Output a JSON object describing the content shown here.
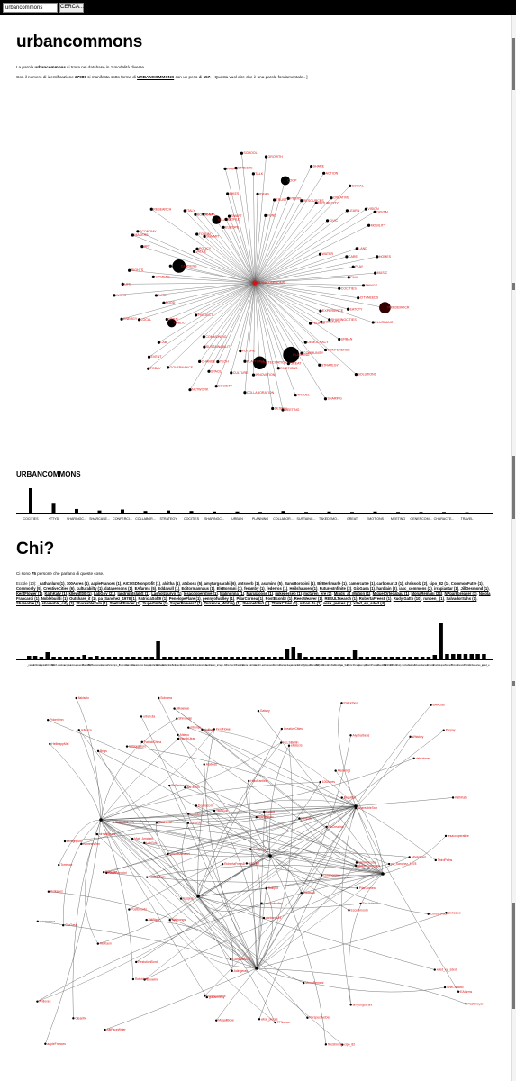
{
  "search": {
    "value": "urbancommons",
    "button_label": "CERCA..."
  },
  "page": {
    "title": "urbancommons"
  },
  "intro": {
    "line1_pre": "La parola ",
    "line1_word": "urbancommons",
    "line1_post": " si trova nei database in 1 modalità diverse",
    "line2_pre": "Con il numero di identificazione ",
    "line2_id": "27980",
    "line2_mid": " si manifesta sotto forma di ",
    "line2_form": "URBANCOMMONS",
    "line2_mid2": " con un peso di ",
    "line2_weight": "157",
    "line2_post": ". [ Questa vuol dire che è una parola fondamentale.. ]"
  },
  "section_urban": {
    "heading": "URBANCOMMONS",
    "chart_data": {
      "type": "bar",
      "categories": [
        "COCITIES",
        "+TTYD",
        "SHARINGC...",
        "SHARCASE...",
        "CONFERCI...",
        "COLLABOR...",
        "STRATEGY",
        "COCITIES",
        "SHARINGC...",
        "URBAN",
        "PLANNING",
        "COLLABOR...",
        "SUSTAINC...",
        "TAKEDEMO...",
        "GREAT",
        "EMOTIONS",
        "MEETING",
        "GENERCOM...",
        "CHARACTE...",
        "TRAVEL"
      ],
      "values": [
        100,
        42,
        18,
        12,
        16,
        10,
        12,
        10,
        8,
        8,
        6,
        10,
        6,
        8,
        6,
        8,
        6,
        6,
        6,
        5
      ]
    }
  },
  "section_chi": {
    "heading": "Chi?",
    "count_pre": "Ci sono ",
    "count": "75",
    "count_post": " persone che parlano di queste cose.",
    "ecco_label": "Eccole (10):",
    "people": [
      "_nathanlurs (1)",
      "100Acres (1)",
      "aapleFrances (1)",
      "AICOSDNonprofit (1)",
      "alvitha (1)",
      "ataboss (5)",
      "amyturgsarahi (6)",
      "antsverb (1)",
      "asamino (5)",
      "BanoBorobini (1)",
      "BirBerkmarle (1)",
      "camercutre (1)",
      "carbonur13 (1)",
      "chrissolz (2)",
      "cipo_82 (1)",
      "CommonFutre (1)",
      "Commonly (5)",
      "CreativeCities (6)",
      "culturabilty (1)",
      "datapersons (1)",
      "EAfarms (5)",
      "Eddavull (1)",
      "Editormannaus (1)",
      "EleBorsani (1)",
      "feramby (1)",
      "federros (1)",
      "Heilshausen (1)",
      "FuturesInfinite (2)",
      "GioGasa (1)",
      "hardlain (2)",
      "iasc_commons (2)",
      "irrapiantar (1)",
      "JillDesmond (1)",
      "KentFlower (1)",
      "KathKaty (1)",
      "kllewitt00 (1)",
      "LabGov (21)",
      "landrightslabS (1)",
      "Lasholzauryo (1)",
      "lesacooperative (1)",
      "Malinonna (1)",
      "MariaLoose (1)",
      "mikeperseo (1)",
      "mctaren_ere (1)",
      "Minds_at_Motion (1)",
      "MiquelOrtegabau (1)",
      "MonaRemani (24)",
      "NPparkbreaker (1)",
      "Nicola Francardi (1)",
      "Noblebuildi (1)",
      "Outshare_it (1)",
      "pa_Sanchez_1978 (1)",
      "PatriciaSoft9 (1)",
      "PenelopeFlare (1)",
      "pennyofwalley (1)",
      "PilarCornea (1)",
      "PostEconbr (1)",
      "ReedWeaver (1)",
      "RESULTsearch (1)",
      "RobertaFrees8 (1)",
      "Rudy Gatto (10)",
      "runben_ (1)",
      "SalvadorSahs (1)",
      "Shareable (1)",
      "shareable_city (3)",
      "ShareableTom (1)",
      "ShellaRFinder (2)",
      "Superfinite (1)",
      "SuperPowers7 (1)",
      "Torrence_Writing (1)",
      "thesnetchid (1)",
      "ThinkCities (1)",
      "urban.ita (1)",
      "wise_pieces (1)",
      "xded_ey_sded (4)"
    ],
    "chart_data": {
      "type": "bar",
      "values": [
        4,
        4,
        3,
        8,
        3,
        3,
        3,
        3,
        3,
        5,
        3,
        4,
        3,
        3,
        3,
        3,
        3,
        3,
        3,
        3,
        3,
        20,
        3,
        3,
        3,
        3,
        3,
        3,
        3,
        3,
        3,
        3,
        3,
        3,
        3,
        3,
        3,
        3,
        3,
        3,
        3,
        3,
        12,
        14,
        7,
        3,
        3,
        3,
        3,
        3,
        3,
        3,
        3,
        11,
        3,
        3,
        3,
        3,
        3,
        3,
        3,
        3,
        3,
        3,
        3,
        3,
        5,
        40,
        6,
        6,
        6,
        6,
        6,
        6,
        6
      ]
    }
  },
  "hub_graph": {
    "center_label": "URBANCOMMONS",
    "labels": [
      "THINGS",
      "COCITIES",
      "CITYNEEDS",
      "TAKEDEMOCR",
      "EATCTY",
      "IN-URBANO",
      "EXPERIENCE",
      "SHARINGCITIES",
      "COMMONS",
      "URBAN",
      "PEOPLE",
      "SOLUTIONS",
      "CONFERENCE",
      "DEMOCRACY",
      "STRATEGY",
      "COMMUNITY",
      "SHARING",
      "PLANNING",
      "GREAT",
      "TRAVEL",
      "EMOTIONS",
      "MEETING",
      "DESIGN",
      "PARTECIPATION",
      "INNOVATION",
      "COLLABORATION",
      "PLATFORM",
      "FUTURE",
      "CULTURE",
      "SOCIETY",
      "TECH",
      "SPACE",
      "NETWORK",
      "CHANGE",
      "SUSTAINABILITY",
      "COMMONING",
      "GOVERNANCE",
      "TODAY",
      "EVENT",
      "LAB",
      "PROJECT",
      "PUBLIC",
      "OPEN",
      "LOCAL",
      "ENERGY",
      "FOOD",
      "DATA",
      "WORK",
      "LIFE",
      "CITIZENS",
      "RIGHTS",
      "HOUSING",
      "GARDENS",
      "ART",
      "MAKERS",
      "ECONOMY",
      "VALUE",
      "POLICY",
      "RESEARCH",
      "FORUM",
      "SUMMIT",
      "ITALY",
      "BOLOGNA",
      "ROMA",
      "MILANO",
      "EUROPE",
      "WORLD",
      "SMART",
      "BIKES",
      "PARKS",
      "STREETS",
      "SCHOOL",
      "TALK",
      "IDEAS",
      "GROWTH",
      "FUND",
      "TRUST",
      "COOP",
      "PEERS",
      "SHARE",
      "RESOURCES",
      "ACTION",
      "FUTURECITY",
      "CREATIVE",
      "SOCIAL",
      "CIVIC",
      "LEARN",
      "VISION",
      "DIGITAL",
      "MOBILITY",
      "WATER",
      "LAND",
      "CARE",
      "HOMES",
      "PLAY",
      "MUSIC",
      "FILM"
    ]
  },
  "people_graph": {
    "labels": [
      "Coops",
      "aapleFrances",
      "Gatsby",
      "Ataboss",
      "100Acres",
      "ShareableTom",
      "ConcertFaure",
      "gohamnesy",
      "shareable_city",
      "MagaliBoxe",
      "CreativeCities",
      "BanoBorobini",
      "LabGov",
      "Blanquitolo",
      "PokerOnn",
      "cammercutre",
      "TPNocca",
      "IshmnesZen",
      "Matt_Amphell",
      "HeiltrappMel",
      "amyturgsarahi",
      "Anikanes",
      "Ricchimai",
      "RestotionBordl",
      "HaloPanfield",
      "PerspectiveDes",
      "lesacooperative",
      "CheCivitano",
      "KentFlower",
      "lesBorgaturo",
      "EcceSmooth",
      "KathKaty",
      "Ilmattero",
      "AltiFaceWriter",
      "MonaRemani",
      "Beautiful",
      "eliSiscrs",
      "cipo_82",
      "KingsBe",
      "Isssjeul",
      "NLLSBerlin",
      "FuturesInfinite",
      "PilarCornea",
      "carbonur13",
      "alvitha",
      "nirmalBruno",
      "xded_ey_sded",
      "ThirdPaths",
      "Aibekilevel",
      "Cleanfix",
      "AisTeRoo",
      "urban.ita",
      "chrissolz",
      "EAfarms",
      "Eddavull",
      "Torrence",
      "DioCase",
      "BirBerkmarle",
      "pennyofwalley",
      "PostEconbr",
      "commercian",
      "flakisolo",
      "tessvisit",
      "conmoncoz",
      "reficoza",
      "gooodsamanzi",
      "fiveShining",
      "datsabrass",
      "Antioxes",
      "Pastimeyar",
      "Eco-tutenal",
      "BAAcitta",
      "Malinongs",
      "GioGasa",
      "Dophaso Il",
      "Cohesiee",
      "HelKaon",
      "Patrurtbes",
      "PatrickGhina",
      "Shivonalp",
      "FarmTerrain",
      "Sullipot",
      "Prepay",
      "mbonsu",
      "Brigs",
      "HendriJiran",
      "Ahleyo",
      "TsukGolf",
      "pa_Sanchez_1978",
      "wise_pieces",
      "PaCreatina",
      "MakerCommons",
      "Unowme",
      "VittRiser",
      "RobertaFrees8",
      "Whiskey",
      "Alongbrighe",
      "Rotchkoe",
      "Aleavings",
      "Aiyaharbens",
      "Adingeras",
      "ACogrigum",
      "Solnarra",
      "GambattiZon",
      "MikaelAlo"
    ]
  },
  "colors": {
    "accent": "#e01010",
    "ink": "#000000",
    "edge": "#555555"
  }
}
